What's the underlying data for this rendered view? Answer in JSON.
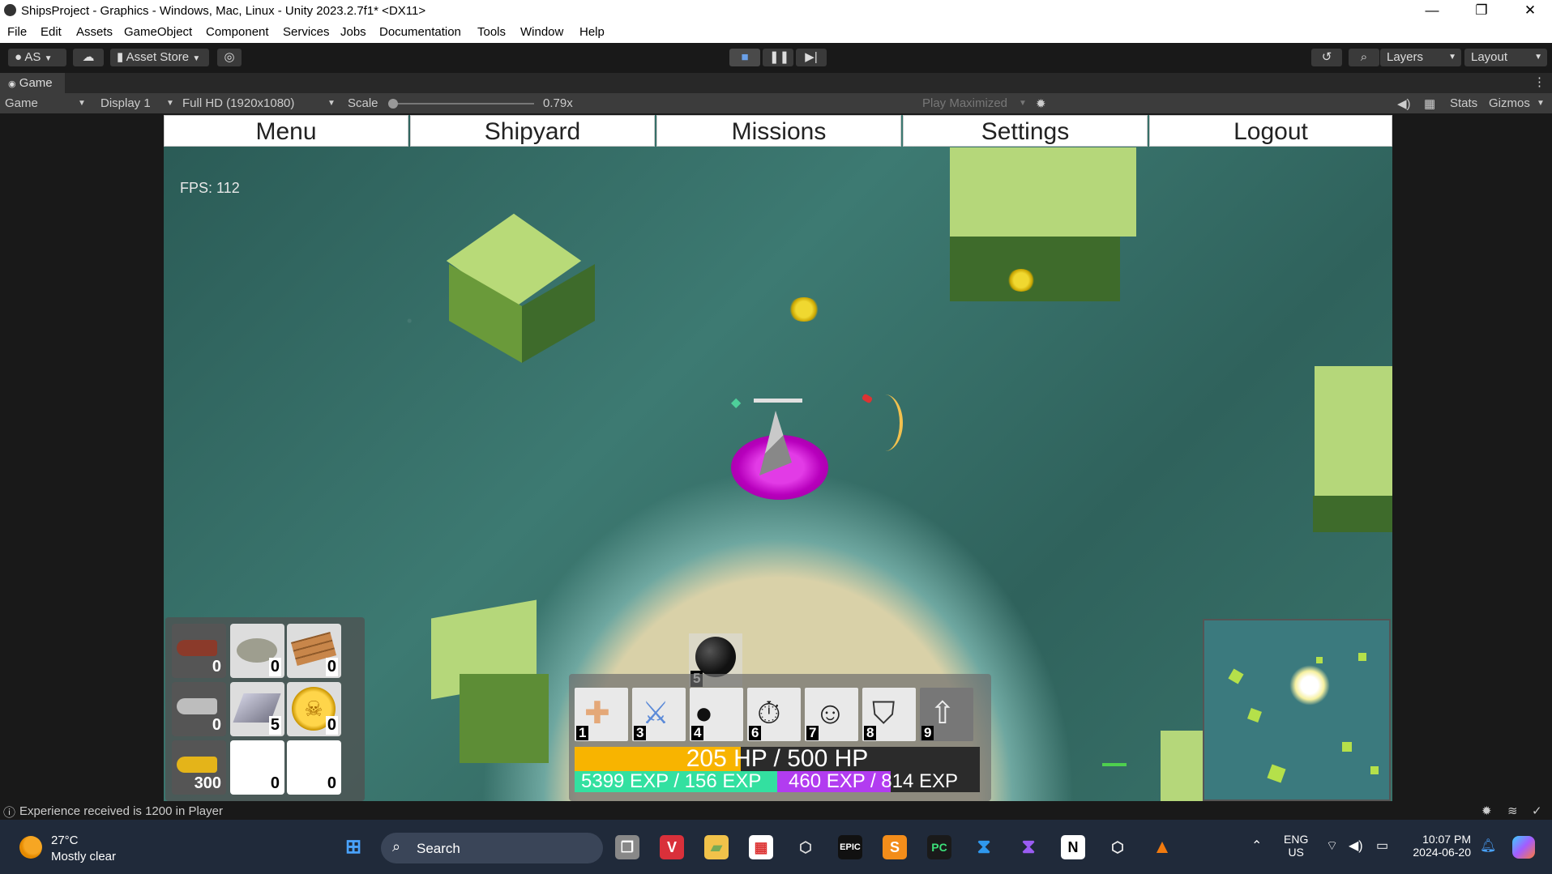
{
  "window": {
    "title": "ShipsProject - Graphics - Windows, Mac, Linux - Unity 2023.2.7f1* <DX11>",
    "controls": [
      "—",
      "❐",
      "✕"
    ]
  },
  "menu": [
    "File",
    "Edit",
    "Assets",
    "GameObject",
    "Component",
    "Services",
    "Jobs",
    "Documentation",
    "Tools",
    "Window",
    "Help"
  ],
  "toolbar": {
    "account": "AS",
    "asset_store": "Asset Store",
    "layers": "Layers",
    "layout": "Layout"
  },
  "game_tab": {
    "label": "Game",
    "mode": "Game",
    "display": "Display 1",
    "resolution": "Full HD (1920x1080)",
    "scale_label": "Scale",
    "scale_value": "0.79x",
    "scale_fraction": 0.0,
    "play_mode": "Play Maximized",
    "stats": "Stats",
    "gizmos": "Gizmos"
  },
  "game": {
    "nav": [
      "Menu",
      "Shipyard",
      "Missions",
      "Settings",
      "Logout"
    ],
    "fps": "FPS: 112",
    "inventory": {
      "cannons": [
        "0",
        "0",
        "300"
      ],
      "resources": [
        "0",
        "0",
        "5",
        "0",
        "0",
        "0"
      ]
    },
    "skills": [
      {
        "key": "1",
        "icon": "bandage-icon"
      },
      {
        "key": "3",
        "icon": "sword-icon"
      },
      {
        "key": "4",
        "icon": "cannonball-icon"
      },
      {
        "key": "6",
        "icon": "stopwatch-icon"
      },
      {
        "key": "7",
        "icon": "add-crew-icon"
      },
      {
        "key": "8",
        "icon": "shield-icon"
      },
      {
        "key": "9",
        "icon": "rocket-icon"
      }
    ],
    "ammo_count": "5",
    "hp_text": "205 HP / 500 HP",
    "hp_fraction": 0.41,
    "exp_left": "5399 EXP / 156 EXP",
    "exp_right": "460 EXP / 814 EXP",
    "colors": {
      "hp": "#f8b400",
      "exp_left": "#33e0a0",
      "exp_right": "#b23cf0",
      "selection": "#cc00cc"
    }
  },
  "status": {
    "message": "Experience received is 1200 in Player"
  },
  "taskbar": {
    "weather_temp": "27°C",
    "weather_desc": "Mostly clear",
    "search": "Search",
    "lang": "ENG",
    "region": "US",
    "time": "10:07 PM",
    "date": "2024-06-20"
  }
}
